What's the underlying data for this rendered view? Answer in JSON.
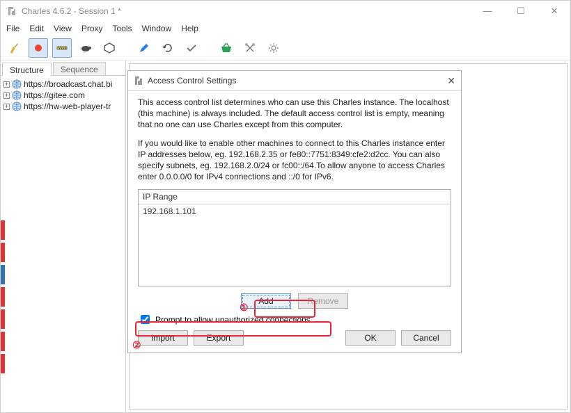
{
  "window": {
    "title": "Charles 4.6.2 - Session 1 *"
  },
  "win_controls": {
    "min": "—",
    "max": "☐",
    "close": "✕"
  },
  "menubar": [
    "File",
    "Edit",
    "View",
    "Proxy",
    "Tools",
    "Window",
    "Help"
  ],
  "tabs": {
    "structure": "Structure",
    "sequence": "Sequence"
  },
  "tree": [
    "https://broadcast.chat.bi",
    "https://gitee.com",
    "https://hw-web-player-tr"
  ],
  "dialog": {
    "title": "Access Control Settings",
    "desc1": "This access control list determines who can use this Charles instance. The localhost (this machine) is always included. The default access control list is empty, meaning that no one can use Charles except from this computer.",
    "desc2": "If you would like to enable other machines to connect to this Charles instance enter IP addresses below, eg. 192.168.2.35 or fe80::7751:8349:cfe2:d2cc. You can also specify subnets, eg. 192.168.2.0/24 or fc00::/64.To allow anyone to access Charles enter 0.0.0.0/0 for IPv4 connections and ::/0 for IPv6.",
    "list_header": "IP Range",
    "list_rows": [
      "192.168.1.101"
    ],
    "add": "Add",
    "remove": "Remove",
    "checkbox_label": "Prompt to allow unauthorized connections",
    "checkbox_checked": true,
    "import": "Import",
    "export": "Export",
    "ok": "OK",
    "cancel": "Cancel"
  },
  "annotations": {
    "num1": "①",
    "num2": "②"
  }
}
